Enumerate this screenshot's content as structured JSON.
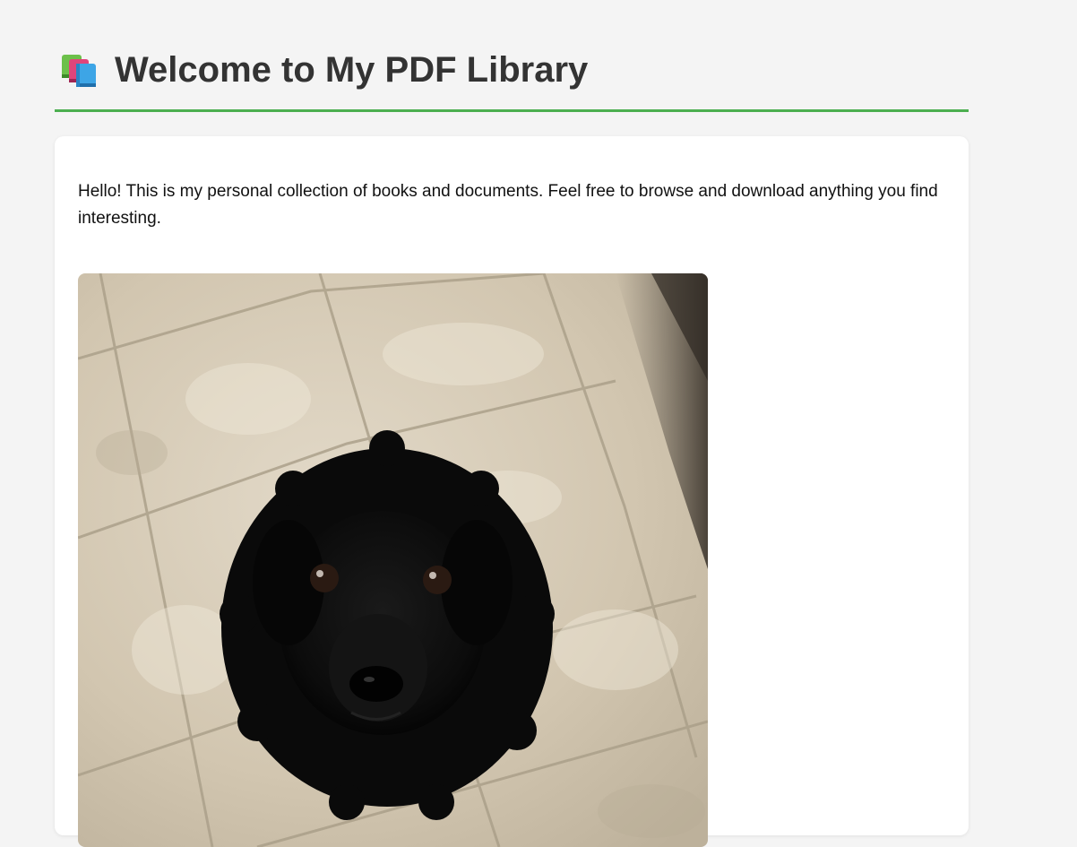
{
  "header": {
    "icon": "books-icon",
    "title": "Welcome to My PDF Library",
    "accent_color": "#4caf50"
  },
  "main": {
    "intro_text": "Hello! This is my personal collection of books and documents. Feel free to browse and download anything you find interesting.",
    "photo": {
      "kind": "photo of a black dog on a tile floor"
    }
  }
}
